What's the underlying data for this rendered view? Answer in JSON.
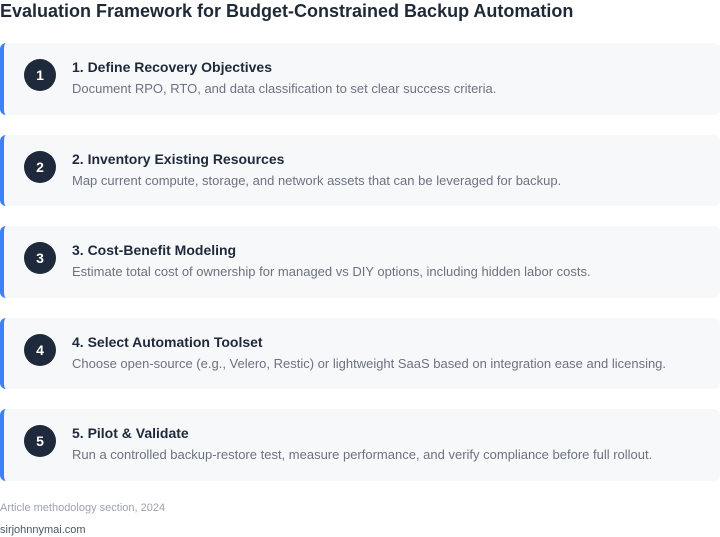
{
  "title": "Evaluation Framework for Budget-Constrained Backup Automation",
  "steps": [
    {
      "number": "1",
      "title": "1. Define Recovery Objectives",
      "description": "Document RPO, RTO, and data classification to set clear success criteria."
    },
    {
      "number": "2",
      "title": "2. Inventory Existing Resources",
      "description": "Map current compute, storage, and network assets that can be leveraged for backup."
    },
    {
      "number": "3",
      "title": "3. Cost-Benefit Modeling",
      "description": "Estimate total cost of ownership for managed vs DIY options, including hidden labor costs."
    },
    {
      "number": "4",
      "title": "4. Select Automation Toolset",
      "description": "Choose open-source (e.g., Velero, Restic) or lightweight SaaS based on integration ease and licensing."
    },
    {
      "number": "5",
      "title": "5. Pilot & Validate",
      "description": "Run a controlled backup-restore test, measure performance, and verify compliance before full rollout."
    }
  ],
  "footer": {
    "source": "Article methodology section, 2024",
    "site": "sirjohnnymai.com"
  },
  "colors": {
    "accent": "#3b82f6",
    "badge": "#1e293b",
    "card_background": "#f7f8fa"
  }
}
